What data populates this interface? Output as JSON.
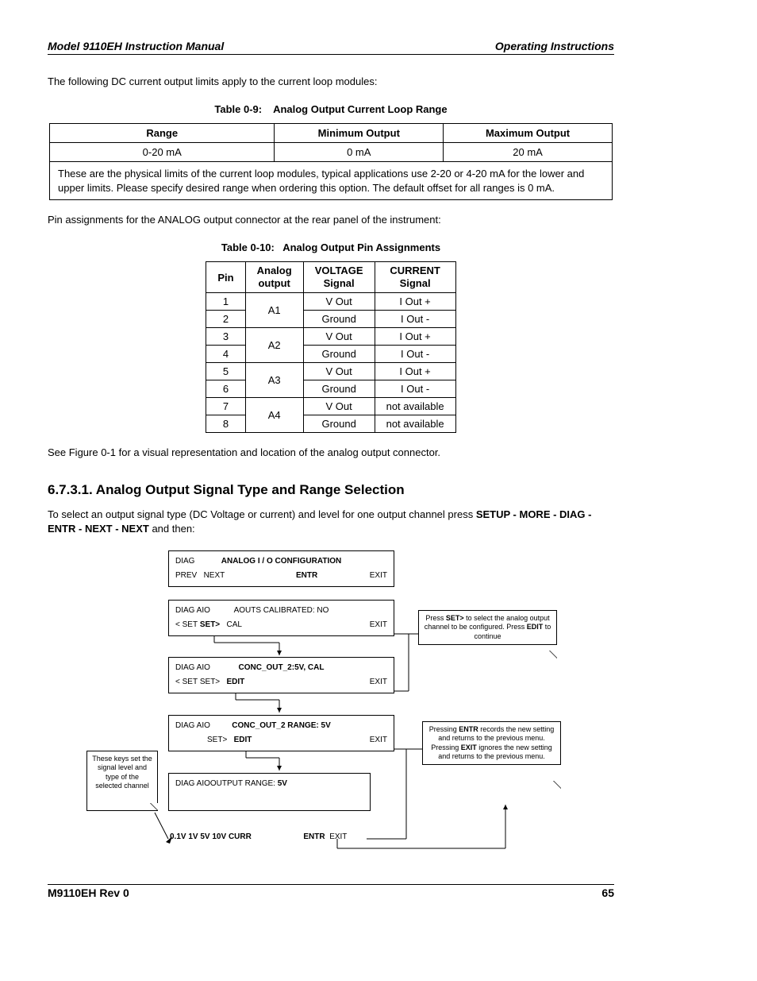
{
  "header": {
    "left": "Model 9110EH Instruction Manual",
    "right": "Operating Instructions"
  },
  "intro1": "The following DC current output limits apply to the current loop modules:",
  "table9": {
    "caption_label": "Table 0-9:",
    "caption_title": "Analog Output Current Loop Range",
    "h1": "Range",
    "h2": "Minimum Output",
    "h3": "Maximum Output",
    "r1c1": "0-20 mA",
    "r1c2": "0 mA",
    "r1c3": "20 mA",
    "note": "These are the physical limits of the current loop modules, typical applications use 2-20 or 4-20 mA for the lower and upper limits. Please specify desired range when ordering this option. The default offset for all ranges is 0 mA."
  },
  "intro2": "Pin assignments for the ANALOG output connector at the rear panel of the instrument:",
  "table10": {
    "caption_label": "Table 0-10:",
    "caption_title": "Analog Output Pin Assignments",
    "h1": "Pin",
    "h2": "Analog output",
    "h3": "VOLTAGE Signal",
    "h4": "CURRENT Signal",
    "rows": [
      {
        "pin": "1",
        "ao": "A1",
        "v": "V Out",
        "c": "I Out +"
      },
      {
        "pin": "2",
        "ao": "",
        "v": "Ground",
        "c": "I Out -"
      },
      {
        "pin": "3",
        "ao": "A2",
        "v": "V Out",
        "c": "I Out +"
      },
      {
        "pin": "4",
        "ao": "",
        "v": "Ground",
        "c": "I Out -"
      },
      {
        "pin": "5",
        "ao": "A3",
        "v": "V Out",
        "c": "I Out +"
      },
      {
        "pin": "6",
        "ao": "",
        "v": "Ground",
        "c": "I Out -"
      },
      {
        "pin": "7",
        "ao": "A4",
        "v": "V Out",
        "c": "not available"
      },
      {
        "pin": "8",
        "ao": "",
        "v": "Ground",
        "c": "not available"
      }
    ]
  },
  "intro3": "See Figure 0-1 for a visual representation and location of the analog output connector.",
  "section_title": "6.7.3.1. Analog Output Signal Type and Range Selection",
  "sec_para_a": "To select an output signal type (DC Voltage or current) and level for one output channel press ",
  "sec_para_b": "SETUP - MORE - DIAG - ENTR - NEXT - NEXT",
  "sec_para_c": " and then:",
  "diagram": {
    "box1": {
      "tl": "DIAG",
      "tc": "ANALOG I / O CONFIGURATION",
      "bl": "PREV",
      "bl2": "NEXT",
      "bc": "ENTR",
      "br": "EXIT"
    },
    "box2": {
      "tl": "DIAG AIO",
      "tc": "AOUTS CALIBRATED: NO",
      "bl": "< SET",
      "bb": "SET>",
      "bl2": "CAL",
      "br": "EXIT"
    },
    "box3": {
      "tl": "DIAG AIO",
      "tc": "CONC_OUT_2:5V, CAL",
      "bl": "< SET",
      "bl1": "SET>",
      "bc": "EDIT",
      "br": "EXIT"
    },
    "box4": {
      "tl": "DIAG AIO",
      "tc": "CONC_OUT_2 RANGE: 5V",
      "bl": "SET>",
      "bc": "EDIT",
      "br": "EXIT"
    },
    "box5": {
      "tl": "DIAG AIOOUTPUT RANGE:",
      "tb": "5V",
      "opts": "0.1V   1V    5V   10V   CURR",
      "bc": "ENTR",
      "br": "EXIT"
    },
    "call_left": "These keys set the signal level and type of the selected channel",
    "call_r1a": "Press ",
    "call_r1b": "SET>",
    "call_r1c": " to select the analog output channel to be configured. Press ",
    "call_r1d": "EDIT",
    "call_r1e": " to continue",
    "call_r2a": "Pressing ",
    "call_r2b": "ENTR",
    "call_r2c": " records the new setting and returns to the previous menu.",
    "call_r2d": "Pressing ",
    "call_r2e": "EXIT",
    "call_r2f": " ignores the new setting and returns to the previous menu."
  },
  "footer": {
    "left": "M9110EH Rev 0",
    "right": "65"
  }
}
